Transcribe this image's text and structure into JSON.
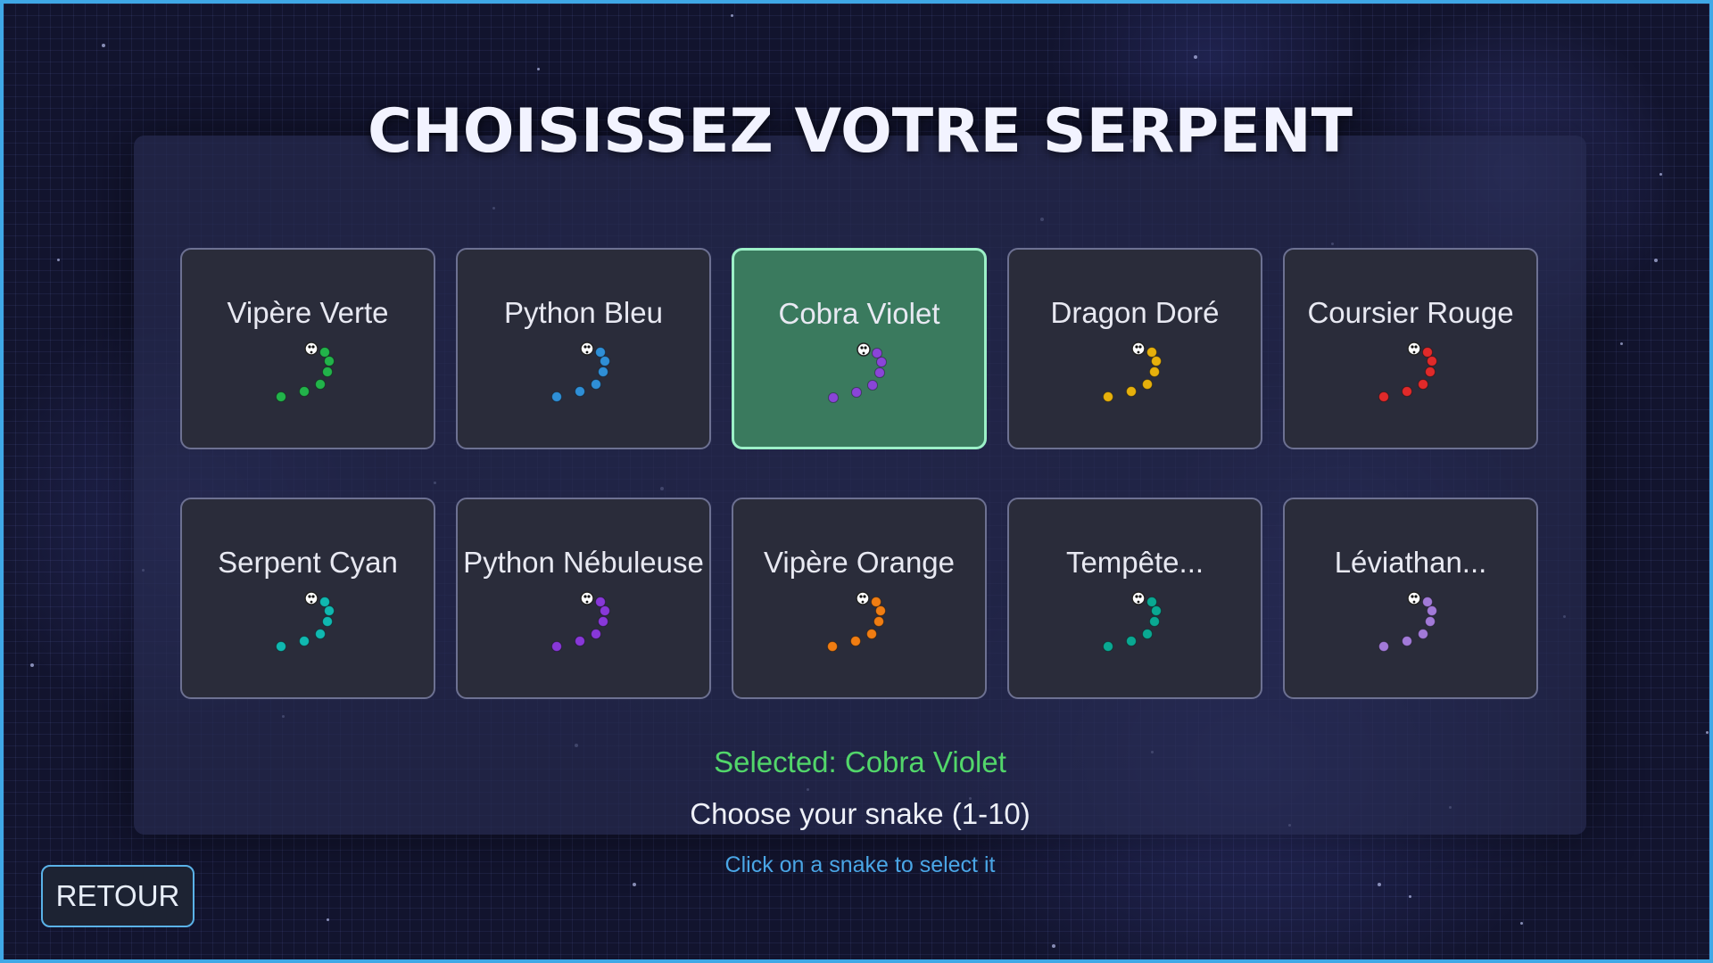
{
  "screen": {
    "title": "CHOISISSEZ VOTRE SERPENT",
    "selected_text": "Selected: Cobra Violet",
    "choose_text": "Choose your snake (1-10)",
    "hint_text": "Click on a snake to select it",
    "back_label": "RETOUR"
  },
  "selected_index": 2,
  "snakes": [
    {
      "name": "Vipère Verte",
      "color": "#22b34a"
    },
    {
      "name": "Python Bleu",
      "color": "#2f8fd6"
    },
    {
      "name": "Cobra Violet",
      "color": "#8a45d8"
    },
    {
      "name": "Dragon Doré",
      "color": "#e6b00c"
    },
    {
      "name": "Coursier Rouge",
      "color": "#e02a2a"
    },
    {
      "name": "Serpent Cyan",
      "color": "#10b8b0"
    },
    {
      "name": "Python Nébuleuse",
      "color": "#8838d8"
    },
    {
      "name": "Vipère Orange",
      "color": "#f07d12"
    },
    {
      "name": "Tempête...",
      "color": "#0aa892"
    },
    {
      "name": "Léviathan...",
      "color": "#a27ad8"
    }
  ],
  "colors": {
    "accent_border": "#3fa8e6",
    "selected_card": "#3a7a5e",
    "selected_text": "#52d66a",
    "hint_text": "#4aa6e6"
  }
}
